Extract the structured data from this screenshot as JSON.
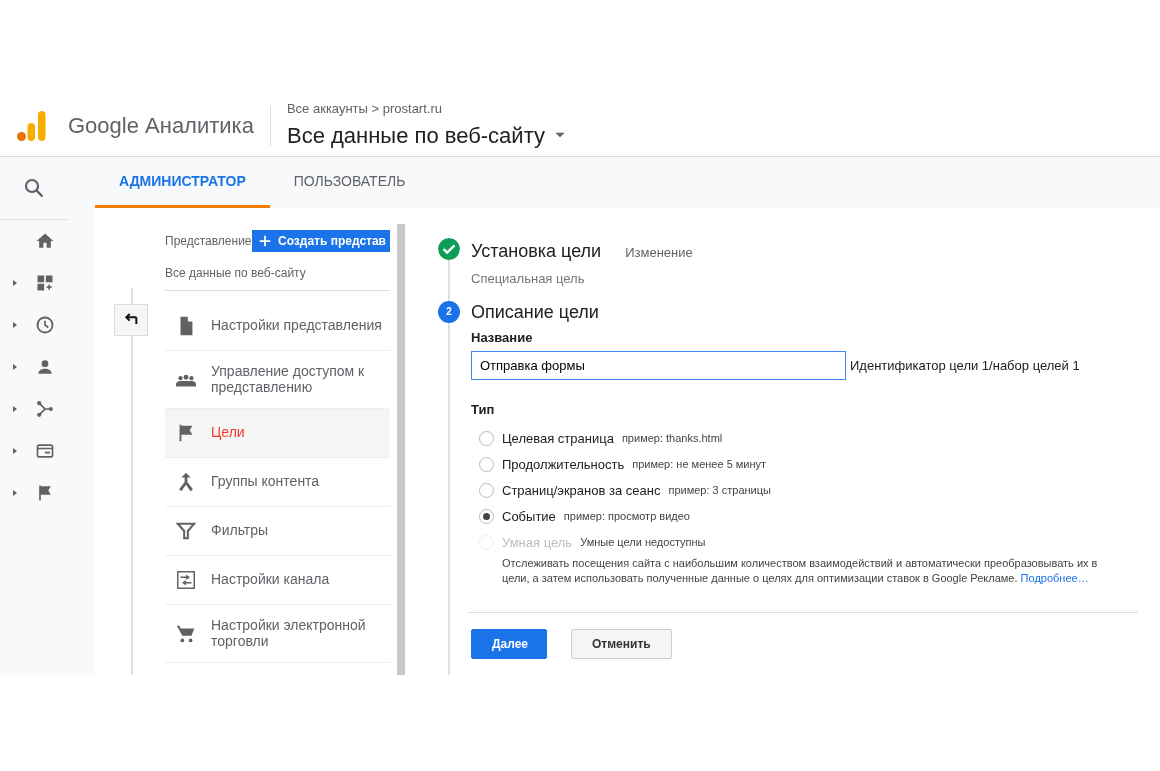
{
  "header": {
    "product": "Google Аналитика",
    "breadcrumb": "Все аккаунты > prostart.ru",
    "view_title": "Все данные по веб-сайту"
  },
  "tabs": [
    {
      "label": "АДМИНИСТРАТОР",
      "selected": true
    },
    {
      "label": "ПОЛЬЗОВАТЕЛЬ",
      "selected": false
    }
  ],
  "rail": [
    {
      "kind": "home"
    },
    {
      "kind": "dashboard"
    },
    {
      "kind": "clock"
    },
    {
      "kind": "person"
    },
    {
      "kind": "branch"
    },
    {
      "kind": "card"
    },
    {
      "kind": "flag"
    }
  ],
  "view_panel": {
    "label": "Представление",
    "create_button": "Создать представ",
    "view_name": "Все данные по веб-сайту",
    "items": [
      {
        "kind": "document",
        "label": "Настройки представления",
        "selected": false
      },
      {
        "kind": "people",
        "label": "Управление доступом к представлению",
        "selected": false
      },
      {
        "kind": "flag",
        "label": "Цели",
        "selected": true
      },
      {
        "kind": "merge",
        "label": "Группы контента",
        "selected": false
      },
      {
        "kind": "filter",
        "label": "Фильтры",
        "selected": false
      },
      {
        "kind": "channel",
        "label": "Настройки канала",
        "selected": false
      },
      {
        "kind": "cart",
        "label": "Настройки электронной торговли",
        "selected": false
      }
    ]
  },
  "steps": [
    {
      "completed": true,
      "title": "Установка цели",
      "action": "Изменение",
      "summary": "Специальная цель"
    },
    {
      "completed": false,
      "number": "2",
      "title": "Описание цели"
    }
  ],
  "form": {
    "name_label": "Название",
    "name_value": "Отправка формы",
    "goal_id": "Идентификатор цели 1/набор целей 1",
    "type_label": "Тип",
    "options": [
      {
        "label": "Целевая страница",
        "hint": "пример: thanks.html",
        "selected": false,
        "disabled": false
      },
      {
        "label": "Продолжительность",
        "hint": "пример: не менее 5 минут",
        "selected": false,
        "disabled": false
      },
      {
        "label": "Страниц/экранов за сеанс",
        "hint": "пример: 3 страницы",
        "selected": false,
        "disabled": false
      },
      {
        "label": "Событие",
        "hint": "пример: просмотр видео",
        "selected": true,
        "disabled": false
      },
      {
        "label": "Умная цель",
        "hint": "Умные цели недоступны",
        "selected": false,
        "disabled": true
      }
    ],
    "smart_description": "Отслеживать посещения сайта с наибольшим количеством взаимодействий и автоматически преобразовывать их в цели, а затем использовать полученные данные о целях для оптимизации ставок в Google Рекламе.",
    "more_link": "Подробнее…",
    "buttons": [
      {
        "kind": "primary",
        "label": "Далее"
      },
      {
        "kind": "secondary",
        "label": "Отменить"
      }
    ]
  }
}
